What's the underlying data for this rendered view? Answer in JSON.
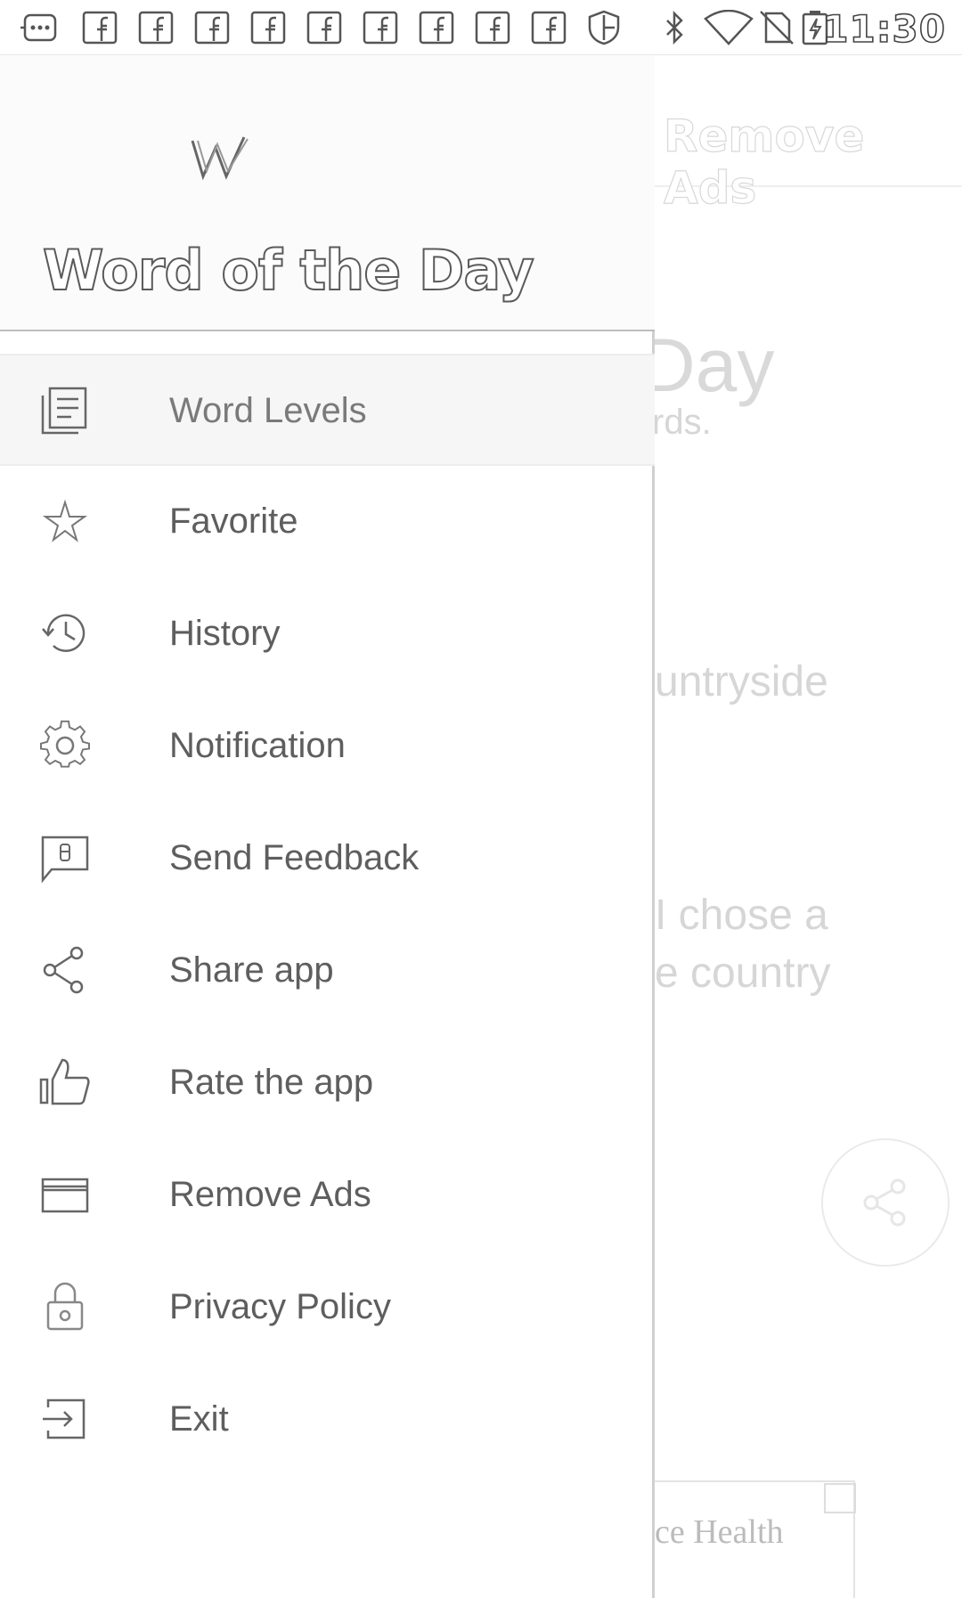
{
  "status_bar": {
    "time": "11:30",
    "icons": [
      "notification-more-icon",
      "facebook-icon",
      "facebook-icon",
      "facebook-icon",
      "facebook-icon",
      "facebook-icon",
      "facebook-icon",
      "facebook-icon",
      "facebook-icon",
      "facebook-icon",
      "shield-icon",
      "bluetooth-icon",
      "wifi-icon",
      "no-sim-icon",
      "battery-charging-icon"
    ]
  },
  "background_app": {
    "top_action": "Remove Ads",
    "title_fragment": "Day",
    "subtitle_fragment": "rds.",
    "word_fragment": "untryside",
    "example_line1_fragment": "I chose a",
    "example_line2_fragment": "e country",
    "ad_text_fragment": "ce Health"
  },
  "drawer": {
    "logo_icon": "w-logo-icon",
    "title": "Word of the Day",
    "items": [
      {
        "label": "Word Levels",
        "icon": "list-icon",
        "selected": true
      },
      {
        "label": "Favorite",
        "icon": "star-icon"
      },
      {
        "label": "History",
        "icon": "history-icon"
      },
      {
        "label": "Notification",
        "icon": "gear-icon"
      },
      {
        "label": "Send Feedback",
        "icon": "feedback-icon"
      },
      {
        "label": "Share app",
        "icon": "share-icon"
      },
      {
        "label": "Rate the app",
        "icon": "thumbs-up-icon"
      },
      {
        "label": "Remove Ads",
        "icon": "card-icon"
      },
      {
        "label": "Privacy Policy",
        "icon": "lock-icon"
      },
      {
        "label": "Exit",
        "icon": "exit-icon"
      }
    ]
  }
}
